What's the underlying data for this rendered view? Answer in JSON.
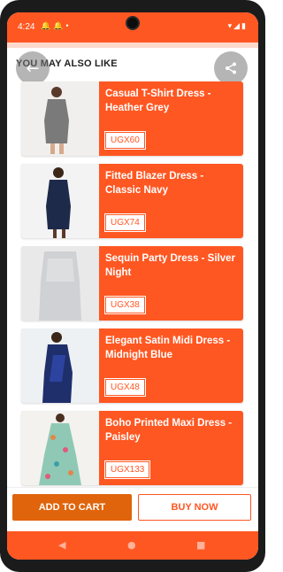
{
  "status_bar": {
    "time": "4:24",
    "left_icons": [
      "notification-icon",
      "notification-icon",
      "dot-icon"
    ],
    "right_icons": [
      "wifi-icon",
      "signal-icon",
      "battery-icon"
    ]
  },
  "header": {
    "section_title": "YOU MAY ALSO LIKE",
    "back_icon": "arrow-back-icon",
    "share_icon": "share-icon"
  },
  "products": [
    {
      "title": "Casual T-Shirt Dress - Heather Grey",
      "price": "UGX60"
    },
    {
      "title": "Fitted Blazer Dress - Classic Navy",
      "price": "UGX74"
    },
    {
      "title": "Sequin Party Dress - Silver Night",
      "price": "UGX38"
    },
    {
      "title": "Elegant Satin Midi Dress - Midnight Blue",
      "price": "UGX48"
    },
    {
      "title": "Boho Printed Maxi Dress - Paisley",
      "price": "UGX133"
    }
  ],
  "actions": {
    "add_to_cart": "ADD TO CART",
    "buy_now": "BUY NOW"
  },
  "colors": {
    "accent": "#ff5722",
    "cart_button": "#e0640b"
  }
}
